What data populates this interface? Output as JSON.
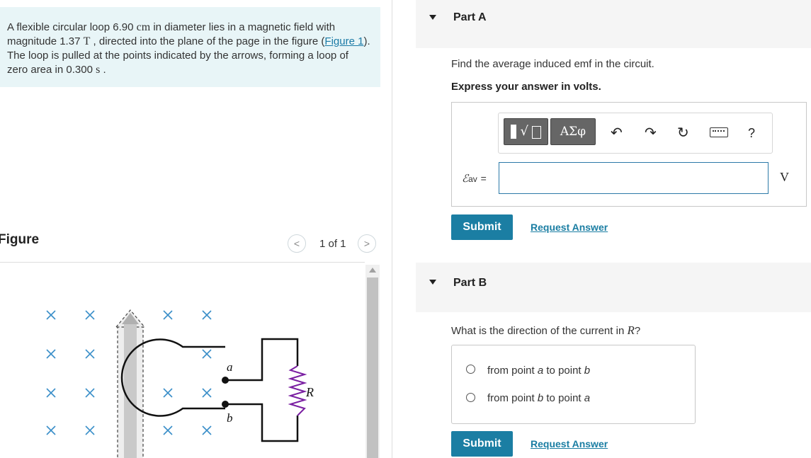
{
  "problem": {
    "text_1": "A flexible circular loop 6.90 ",
    "unit_cm": "cm",
    "text_2": " in diameter lies in a magnetic field with magnitude 1.37 ",
    "unit_T": "T",
    "text_3": " , directed into the plane of the page in the figure (",
    "figure_link": "Figure 1",
    "text_4": "). The loop is pulled at the points indicated by the arrows, forming a loop of zero area in 0.300 ",
    "unit_s": "s",
    "text_5": " ."
  },
  "figure": {
    "title": "Figure",
    "pager_text": "1 of 1",
    "prev_icon": "chevron-left-icon",
    "next_icon": "chevron-right-icon",
    "label_a": "a",
    "label_b": "b",
    "label_R": "R"
  },
  "part_a": {
    "title": "Part A",
    "question": "Find the average induced emf in the circuit.",
    "instruction": "Express your answer in volts.",
    "toolbar": {
      "templates_icon": "radical-template-icon",
      "symbols_label": "ΑΣφ",
      "undo_icon": "undo-icon",
      "redo_icon": "redo-icon",
      "reset_icon": "reset-icon",
      "keyboard_icon": "keyboard-icon",
      "help_label": "?"
    },
    "var_symbol": "ℰ",
    "var_sub": "av",
    "equals": "=",
    "answer_value": "",
    "unit": "V",
    "submit_label": "Submit",
    "request_label": "Request Answer"
  },
  "part_b": {
    "title": "Part B",
    "question_prefix": "What is the direction of the current in ",
    "question_var": "R",
    "question_suffix": "?",
    "options": [
      {
        "prefix": "from point ",
        "p1": "a",
        "mid": " to point ",
        "p2": "b"
      },
      {
        "prefix": "from point ",
        "p1": "b",
        "mid": " to point ",
        "p2": "a"
      }
    ],
    "submit_label": "Submit",
    "request_label": "Request Answer"
  },
  "colors": {
    "accent": "#1b7ea3",
    "problem_bg": "#e8f5f7",
    "field_marker": "#3a8fc9"
  }
}
